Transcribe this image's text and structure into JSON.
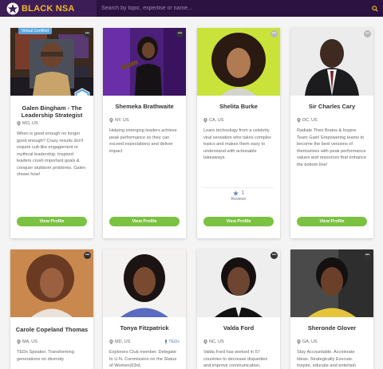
{
  "header": {
    "brand": "BLACK NSA",
    "search_placeholder": "Search by topic, expertise or name...",
    "colors": {
      "bar": "#3d1d56",
      "search": "#2c1240",
      "brand": "#f0b92a"
    }
  },
  "badges": {
    "virtual_certified": "Virtual Certified"
  },
  "speakers": [
    {
      "name": "Galen Bingham - The Leadership Strategist",
      "location": "MO, US",
      "description": "When is good enough no longer good enough? Crazy results don't require cult-like engagement or mythical leadership. Inspired leaders crush important goals & conquer stubborn problems. Galen shows how!",
      "button": "View Profile"
    },
    {
      "name": "Shemeka Brathwaite",
      "location": "NY, US",
      "description": "Helping emerging leaders achieve peak performance so they can exceed expectations and deliver impact",
      "button": "View Profile"
    },
    {
      "name": "Shelita Burke",
      "location": "CA, US",
      "description": "Learn technology from a celebrity viral sensation who takes complex topics and makes them easy to understand with actionable takeaways.",
      "reviews_count": "1",
      "reviews_label": "Reviews",
      "button": "View Profile"
    },
    {
      "name": "Sir Charles Cary",
      "location": "DC, US",
      "description": "Radiate Their Brains & Inspire Team Gain! Empowering teams to become the best versions of themselves with peak performance values and resources that enhance the bottom line!",
      "button": "View Profile"
    },
    {
      "name": "Carole Copeland Thomas",
      "location": "MA, US",
      "description": "TEDx Speaker. Transforming generations on diversity"
    },
    {
      "name": "Tonya Fitzpatrick",
      "location": "MD, US",
      "tag": "TEDx",
      "description": "Explorers Club member. Delegate to U.N. Commission on the Status of Women(63rd,"
    },
    {
      "name": "Valda Ford",
      "location": "NC, US",
      "description": "Valda Ford has worked in 57 countries to decrease disparities and improve communication,"
    },
    {
      "name": "Sheronde Glover",
      "location": "GA, US",
      "description": "Stay Accountable. Accelerate Ideas. Strategically Execute. Inspire, educate and entertain"
    }
  ]
}
